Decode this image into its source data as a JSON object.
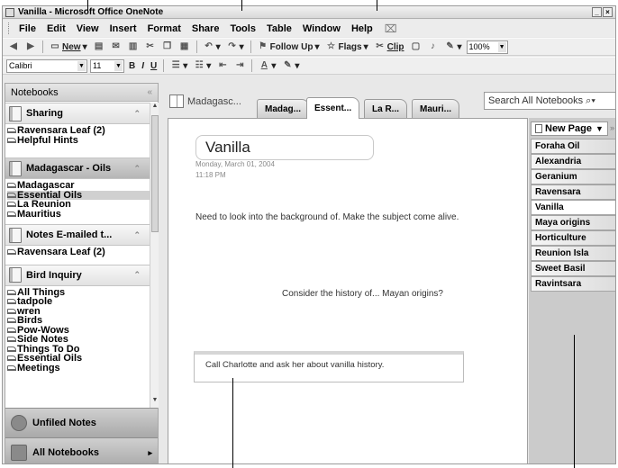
{
  "window": {
    "title": "Vanilla - Microsoft Office OneNote"
  },
  "menu": {
    "items": [
      "File",
      "Edit",
      "View",
      "Insert",
      "Format",
      "Share",
      "Tools",
      "Table",
      "Window",
      "Help"
    ]
  },
  "toolbar1": {
    "new_label": "New",
    "follow_up_label": "Follow Up",
    "flags_label": "Flags",
    "clip_label": "Clip",
    "zoom_value": "100%"
  },
  "toolbar2": {
    "font_name": "Calibri",
    "font_size": "11",
    "bold_label": "B",
    "italic_label": "I",
    "underline_label": "U"
  },
  "nav": {
    "header": "Notebooks",
    "collapse_glyph": "«",
    "notebooks": [
      {
        "name": "Sharing",
        "sections": [
          "Ravensara Leaf (2)",
          "Helpful Hints"
        ]
      },
      {
        "name": "Madagascar - Oils",
        "sections": [
          "Madagascar",
          "Essential Oils",
          "La Reunion",
          "Mauritius"
        ]
      },
      {
        "name": "Notes E-mailed t...",
        "sections": [
          "Ravensara Leaf (2)"
        ]
      },
      {
        "name": "Bird Inquiry",
        "sections": [
          "All Things",
          "tadpole",
          "wren",
          "Birds",
          "Pow-Wows",
          "Side Notes",
          "Things To Do",
          "Essential Oils",
          "Meetings"
        ]
      }
    ],
    "unfiled_label": "Unfiled Notes",
    "all_notebooks_label": "All Notebooks"
  },
  "tabs": {
    "notebook_label": "Madagasc...",
    "sections": [
      "Madag...",
      "Essent...",
      "La R...",
      "Mauri..."
    ],
    "search_placeholder": "Search All Notebooks"
  },
  "page": {
    "title": "Vanilla",
    "date": "Monday, March 01, 2004",
    "time": "11:18 PM",
    "note1": "Need to look into the background of. Make the subject come alive.",
    "note2": "Consider the history of... Mayan origins?",
    "note3": "Call Charlotte and ask her about vanilla history."
  },
  "pages": {
    "new_page_label": "New Page",
    "items": [
      "Foraha Oil",
      "Alexandria",
      "Geranium",
      "Ravensara",
      "Vanilla",
      "Maya origins",
      "Horticulture",
      "Reunion Isla",
      "Sweet Basil",
      "Ravintsara"
    ]
  }
}
